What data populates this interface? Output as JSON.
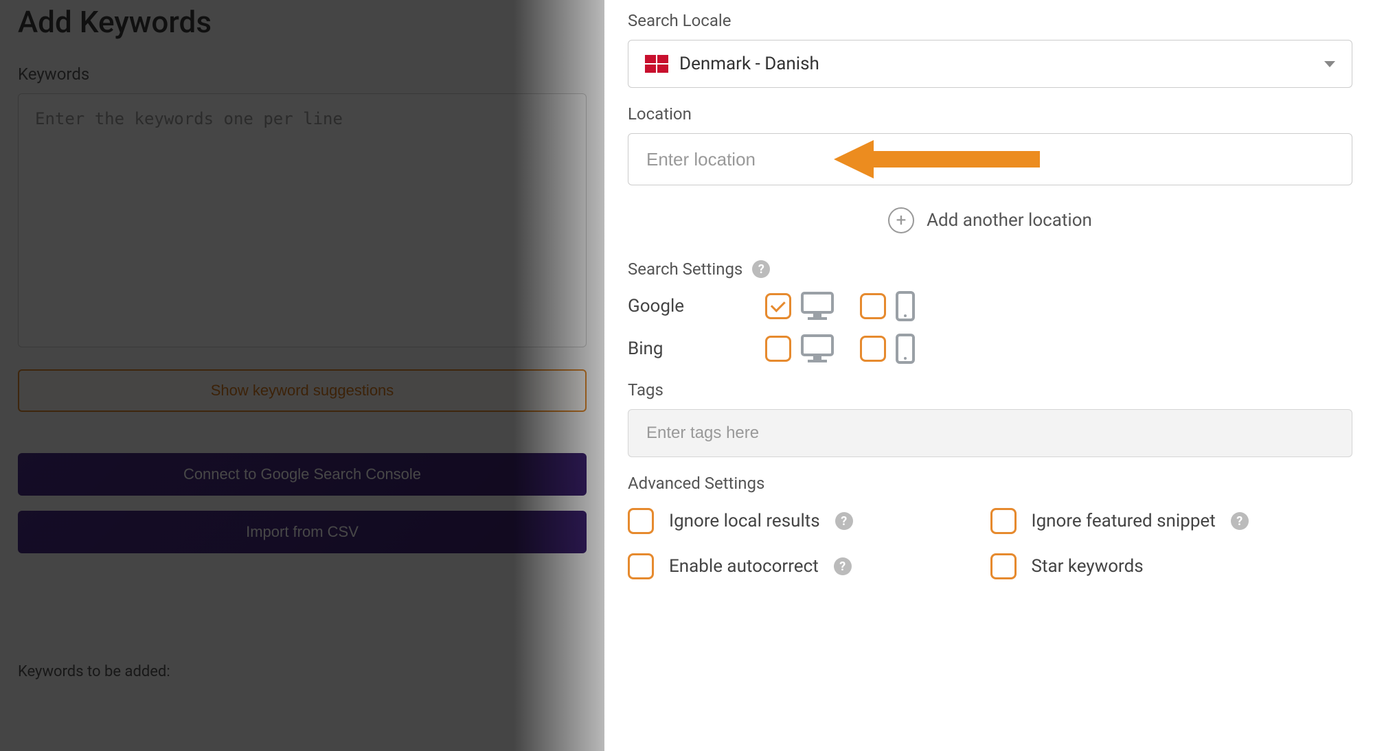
{
  "header": {
    "title": "Add Keywords"
  },
  "keywords": {
    "label": "Keywords",
    "placeholder": "Enter the keywords one per line",
    "suggest_label": "Show keyword suggestions",
    "connect_gsc_label": "Connect to Google Search Console",
    "import_csv_label": "Import from CSV",
    "to_be_added_label": "Keywords to be added:"
  },
  "searchLocale": {
    "label": "Search Locale",
    "value": "Denmark - Danish"
  },
  "location": {
    "label": "Location",
    "placeholder": "Enter location",
    "add_another_label": "Add another location"
  },
  "searchSettings": {
    "label": "Search Settings",
    "engines": {
      "google": {
        "label": "Google",
        "desktop": true,
        "mobile": false
      },
      "bing": {
        "label": "Bing",
        "desktop": false,
        "mobile": false
      }
    }
  },
  "tags": {
    "label": "Tags",
    "placeholder": "Enter tags here"
  },
  "advanced": {
    "label": "Advanced Settings",
    "ignore_local": "Ignore local results",
    "ignore_snippet": "Ignore featured snippet",
    "autocorrect": "Enable autocorrect",
    "star": "Star keywords"
  },
  "colors": {
    "accent_orange": "#e68a2e",
    "purple": "#3d2270"
  }
}
